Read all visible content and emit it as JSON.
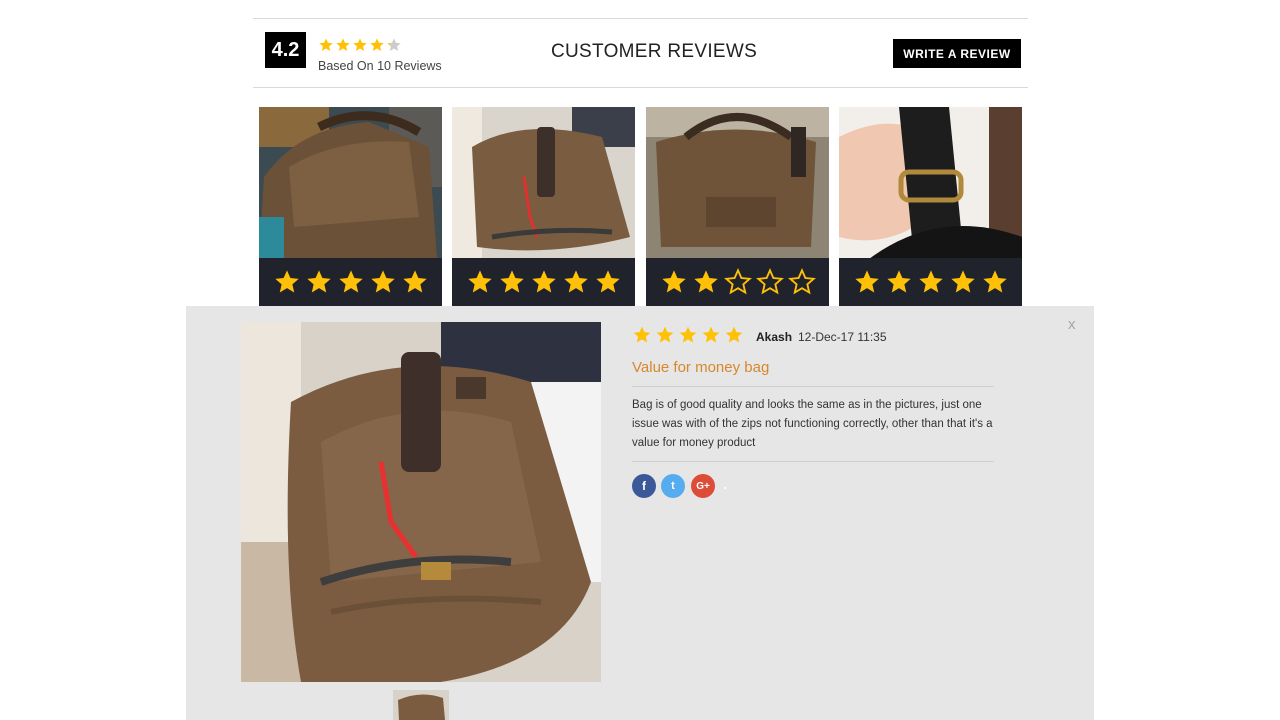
{
  "header": {
    "average_score": "4.2",
    "average_stars": 4.2,
    "based_on": "Based On 10 Reviews",
    "title": "CUSTOMER REVIEWS",
    "write_review_label": "WRITE A REVIEW"
  },
  "thumbnails": [
    {
      "rating": 5
    },
    {
      "rating": 5
    },
    {
      "rating": 2
    },
    {
      "rating": 5
    }
  ],
  "modal": {
    "close_label": "x",
    "review": {
      "rating": 5,
      "reviewer": "Akash",
      "date": "12-Dec-17 11:35",
      "title": "Value for money bag",
      "body": "Bag is of good quality and looks the same as in the pictures, just one issue was with of the zips not functioning correctly, other than that it's a value for money product"
    },
    "share": {
      "facebook": "f",
      "twitter": "t",
      "google": "G+"
    }
  },
  "colors": {
    "star": "#ffc107",
    "star_empty": "#cccccc",
    "accent_title": "#d7872d",
    "modal_bg": "#e6e6e6",
    "star_bar": "#20232b"
  },
  "icons": [
    "star-icon",
    "facebook-icon",
    "twitter-icon",
    "google-plus-icon",
    "close-icon"
  ]
}
